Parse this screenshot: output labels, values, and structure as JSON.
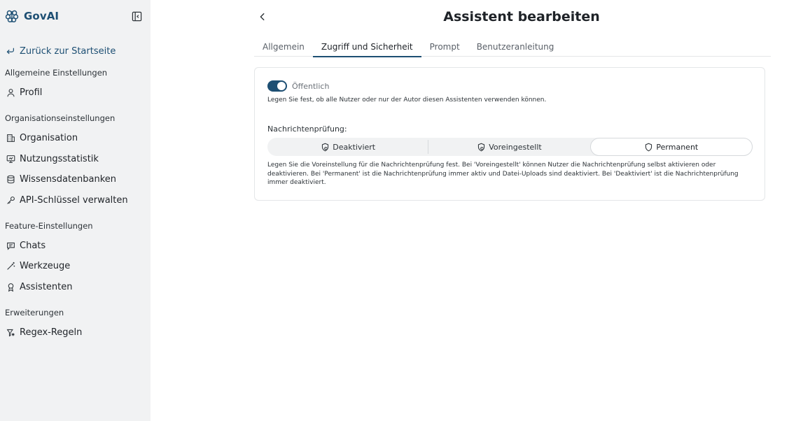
{
  "brand": {
    "name": "GovAI"
  },
  "sidebar": {
    "back_label": "Zurück zur Startseite",
    "sections": [
      {
        "label": "Allgemeine Einstellungen",
        "items": [
          {
            "label": "Profil",
            "icon": "user-icon"
          }
        ]
      },
      {
        "label": "Organisationseinstellungen",
        "items": [
          {
            "label": "Organisation",
            "icon": "building-icon"
          },
          {
            "label": "Nutzungsstatistik",
            "icon": "monitor-icon"
          },
          {
            "label": "Wissensdatenbanken",
            "icon": "database-icon"
          },
          {
            "label": "API-Schlüssel verwalten",
            "icon": "key-icon"
          }
        ]
      },
      {
        "label": "Feature-Einstellungen",
        "items": [
          {
            "label": "Chats",
            "icon": "chat-icon"
          },
          {
            "label": "Werkzeuge",
            "icon": "wand-icon"
          },
          {
            "label": "Assistenten",
            "icon": "award-icon"
          }
        ]
      },
      {
        "label": "Erweiterungen",
        "items": [
          {
            "label": "Regex-Regeln",
            "icon": "regex-icon"
          }
        ]
      }
    ]
  },
  "main": {
    "title": "Assistent bearbeiten",
    "tabs": [
      {
        "label": "Allgemein",
        "active": false
      },
      {
        "label": "Zugriff und Sicherheit",
        "active": true
      },
      {
        "label": "Prompt",
        "active": false
      },
      {
        "label": "Benutzeranleitung",
        "active": false
      }
    ],
    "public_toggle": {
      "label": "Öffentlich",
      "on": true
    },
    "public_help": "Legen Sie fest, ob alle Nutzer oder nur der Autor diesen Assistenten verwenden können.",
    "check_label": "Nachrichtenprüfung:",
    "check_options": [
      {
        "label": "Deaktiviert",
        "active": false
      },
      {
        "label": "Voreingestellt",
        "active": false
      },
      {
        "label": "Permanent",
        "active": true
      }
    ],
    "check_help": "Legen Sie die Voreinstellung für die Nachrichtenprüfung fest. Bei 'Voreingestellt' können Nutzer die Nachrichtenprüfung selbst aktivieren oder deaktivieren. Bei 'Permanent' ist die Nachrichtenprüfung immer aktiv und Datei-Uploads sind deaktiviert. Bei 'Deaktiviert' ist die Nachrichtenprüfung immer deaktiviert."
  },
  "colors": {
    "accent": "#1d4f73",
    "sidebar_bg": "#f1f2f3"
  }
}
